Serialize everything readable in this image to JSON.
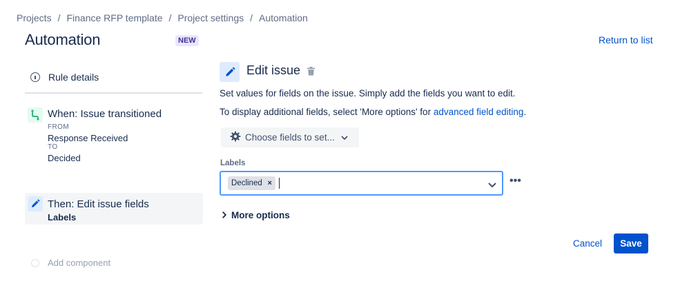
{
  "breadcrumb": [
    "Projects",
    "Finance RFP template",
    "Project settings",
    "Automation"
  ],
  "breadcrumb_separator": "/",
  "page_title": "Automation",
  "badge": "NEW",
  "return_link": "Return to list",
  "sidebar": {
    "rule_details": "Rule details",
    "trigger": {
      "title": "When: Issue transitioned",
      "from_caption": "FROM",
      "from_value": "Response Received",
      "to_caption": "TO",
      "to_value": "Decided"
    },
    "action": {
      "title": "Then: Edit issue fields",
      "subtitle": "Labels"
    },
    "add_component": "Add component"
  },
  "editor": {
    "title": "Edit issue",
    "description": "Set values for fields on the issue. Simply add the fields you want to edit.",
    "more_info_prefix": "To display additional fields, select 'More options' for ",
    "more_info_link": "advanced field editing",
    "more_info_suffix": ".",
    "choose_fields": "Choose fields to set...",
    "labels_field_label": "Labels",
    "labels_tag": "Declined",
    "more_options": "More options",
    "cancel": "Cancel",
    "save": "Save"
  },
  "colors": {
    "link": "#0052cc",
    "focus_border": "#4c9aff",
    "badge_bg": "#eae6ff",
    "badge_text": "#403294",
    "trigger_icon_bg": "#e3fcef",
    "action_icon_bg": "#deebff"
  },
  "icons": {
    "rule_details": "info-icon",
    "trigger": "branch-icon",
    "action": "pencil-icon",
    "delete": "trash-icon",
    "choose_fields": "gear-icon",
    "dropdown": "chevron-down-icon",
    "more": "more-dots-icon",
    "expand": "chevron-right-icon"
  }
}
